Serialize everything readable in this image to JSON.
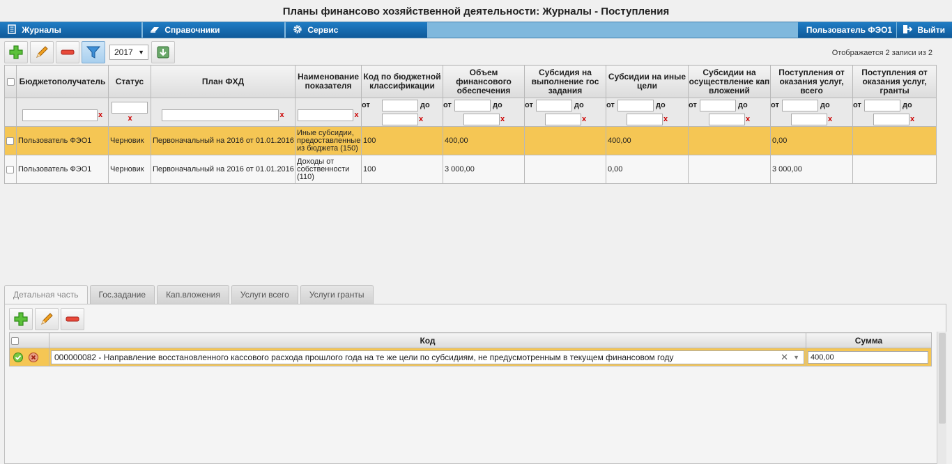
{
  "app_title": "Планы финансово хозяйственной деятельности: Журналы - Поступления",
  "menu": {
    "journals": "Журналы",
    "directories": "Справочники",
    "service": "Сервис",
    "user": "Пользователь ФЭО1",
    "logout": "Выйти"
  },
  "toolbar": {
    "year": "2017",
    "records_info": "Отображается 2 записи из 2"
  },
  "grid": {
    "headers": {
      "recipient": "Бюджетополучатель",
      "status": "Статус",
      "plan": "План ФХД",
      "indicator": "Наименование показателя",
      "code": "Код по бюджетной классификации",
      "volume": "Объем финансового обеспечения",
      "subsidy_gos": "Субсидия на выполнение гос задания",
      "subsidy_other": "Субсидии на иные цели",
      "subsidy_cap": "Субсидии на осуществление кап вложений",
      "services_total": "Поступления от оказания услуг, всего",
      "services_grants": "Поступления от оказания услуг, гранты"
    },
    "filter": {
      "from": "от",
      "to": "до",
      "clear": "x"
    },
    "rows": [
      {
        "recipient": "Пользователь ФЭО1",
        "status": "Черновик",
        "plan": "Первоначальный на 2016 от 01.01.2016",
        "indicator": "Иные субсидии, предоставленные из бюджета (150)",
        "code": "100",
        "volume": "400,00",
        "subsidy_gos": "",
        "subsidy_other": "400,00",
        "subsidy_cap": "",
        "services_total": "0,00",
        "services_grants": ""
      },
      {
        "recipient": "Пользователь ФЭО1",
        "status": "Черновик",
        "plan": "Первоначальный на 2016 от 01.01.2016",
        "indicator": "Доходы от собственности (110)",
        "code": "100",
        "volume": "3 000,00",
        "subsidy_gos": "",
        "subsidy_other": "0,00",
        "subsidy_cap": "",
        "services_total": "3 000,00",
        "services_grants": ""
      }
    ]
  },
  "tabs": [
    "Детальная часть",
    "Гос.задание",
    "Кап.вложения",
    "Услуги всего",
    "Услуги гранты"
  ],
  "detail": {
    "headers": {
      "code": "Код",
      "sum": "Сумма"
    },
    "row": {
      "code": "000000082 - Направление восстановленного кассового расхода прошлого года на те же цели по субсидиям, не предусмотренным в текущем финансовом году",
      "sum": "400,00"
    }
  },
  "icons": {
    "add": "plus-icon",
    "edit": "pencil-icon",
    "delete": "minus-icon",
    "filter": "funnel-icon",
    "export": "export-icon",
    "accent": "#1a6fb3",
    "selection": "#f5c654"
  }
}
